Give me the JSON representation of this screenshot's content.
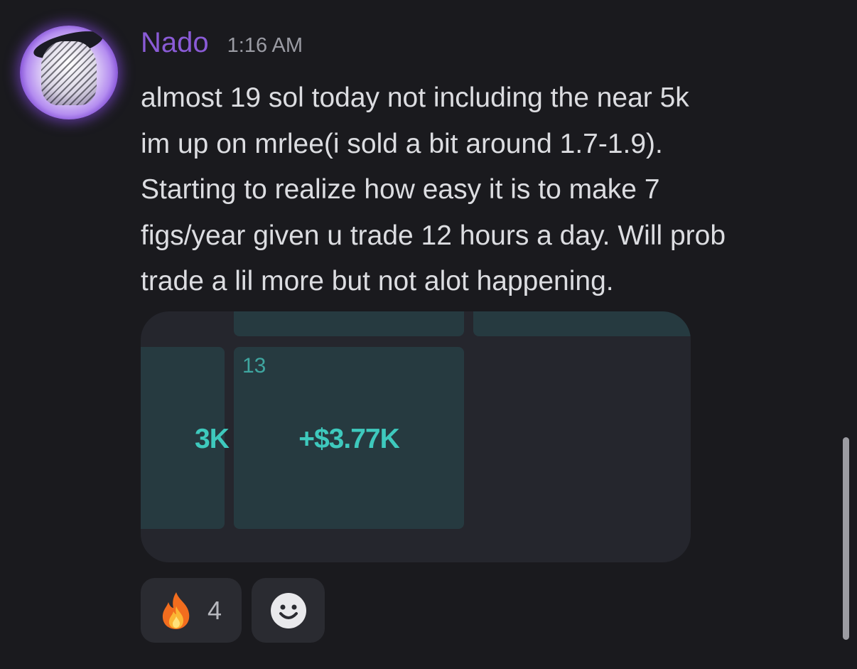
{
  "message": {
    "author": "Nado",
    "timestamp": "1:16 AM",
    "lines": [
      "almost 19 sol today not including the near 5k",
      "im up on mrlee(i sold a bit around 1.7-1.9).",
      "Starting to realize how easy it is to make 7",
      "figs/year given u trade 12 hours a day. Will prob",
      "trade a lil more but not alot happening."
    ],
    "author_color": "#8a5bd6"
  },
  "embed": {
    "left_cell_value": "3K",
    "main_cell_day": "13",
    "main_cell_value": "+$3.77K",
    "value_color": "#3ec9bd"
  },
  "reactions": {
    "fire": {
      "icon": "fire-icon",
      "count": "4"
    },
    "add": {
      "icon": "smiley-add-reaction-icon"
    }
  }
}
